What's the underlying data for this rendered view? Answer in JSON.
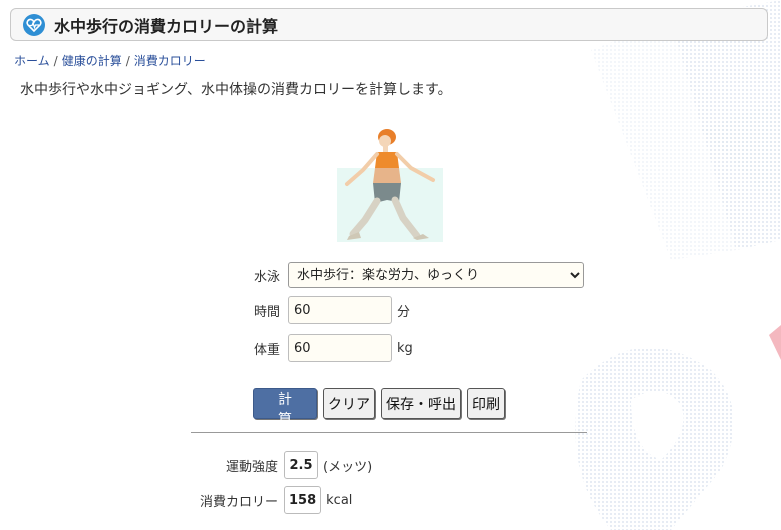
{
  "header": {
    "title": "水中歩行の消費カロリーの計算",
    "icon": "heart-pulse-icon"
  },
  "breadcrumb": {
    "items": [
      "ホーム",
      "健康の計算",
      "消費カロリー"
    ],
    "separator": "/"
  },
  "description": "水中歩行や水中ジョギング、水中体操の消費カロリーを計算します。",
  "form": {
    "activity": {
      "label": "水泳",
      "value": "水中歩行：楽な労力、ゆっくり"
    },
    "time": {
      "label": "時間",
      "value": "60",
      "unit": "分"
    },
    "weight": {
      "label": "体重",
      "value": "60",
      "unit": "kg"
    }
  },
  "buttons": {
    "calculate": "計 算",
    "clear": "クリア",
    "save": "保存・呼出",
    "print": "印刷"
  },
  "results": {
    "intensity": {
      "label": "運動強度",
      "value": "2.5",
      "unit": "(メッツ)"
    },
    "calories": {
      "label": "消費カロリー",
      "value": "158",
      "unit": "kcal"
    }
  },
  "colors": {
    "primary_button": "#4e6fa3",
    "title_icon": "#2f8fd4",
    "link": "#2a4f9a"
  }
}
